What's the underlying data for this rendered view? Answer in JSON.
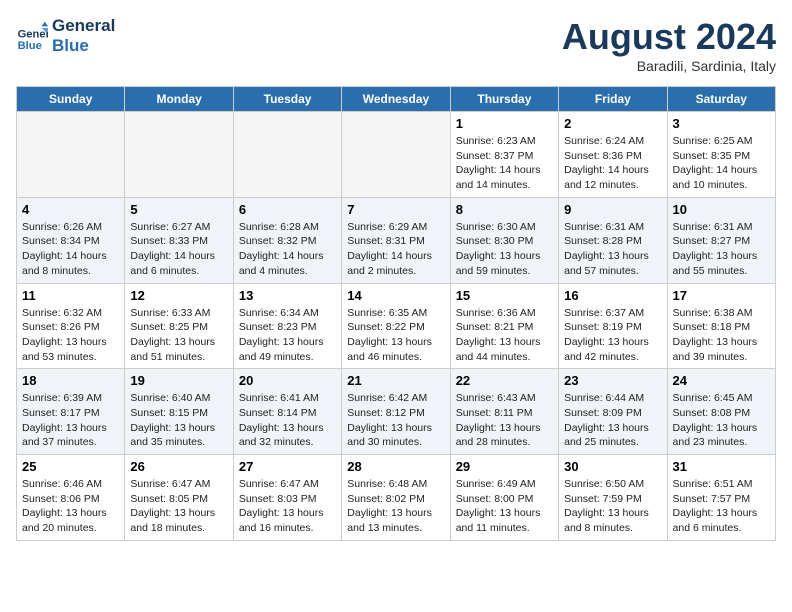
{
  "header": {
    "logo_line1": "General",
    "logo_line2": "Blue",
    "month": "August 2024",
    "location": "Baradili, Sardinia, Italy"
  },
  "days_of_week": [
    "Sunday",
    "Monday",
    "Tuesday",
    "Wednesday",
    "Thursday",
    "Friday",
    "Saturday"
  ],
  "weeks": [
    [
      {
        "day": "",
        "empty": true
      },
      {
        "day": "",
        "empty": true
      },
      {
        "day": "",
        "empty": true
      },
      {
        "day": "",
        "empty": true
      },
      {
        "day": "1",
        "sunrise": "6:23 AM",
        "sunset": "8:37 PM",
        "daylight": "14 hours and 14 minutes."
      },
      {
        "day": "2",
        "sunrise": "6:24 AM",
        "sunset": "8:36 PM",
        "daylight": "14 hours and 12 minutes."
      },
      {
        "day": "3",
        "sunrise": "6:25 AM",
        "sunset": "8:35 PM",
        "daylight": "14 hours and 10 minutes."
      }
    ],
    [
      {
        "day": "4",
        "sunrise": "6:26 AM",
        "sunset": "8:34 PM",
        "daylight": "14 hours and 8 minutes."
      },
      {
        "day": "5",
        "sunrise": "6:27 AM",
        "sunset": "8:33 PM",
        "daylight": "14 hours and 6 minutes."
      },
      {
        "day": "6",
        "sunrise": "6:28 AM",
        "sunset": "8:32 PM",
        "daylight": "14 hours and 4 minutes."
      },
      {
        "day": "7",
        "sunrise": "6:29 AM",
        "sunset": "8:31 PM",
        "daylight": "14 hours and 2 minutes."
      },
      {
        "day": "8",
        "sunrise": "6:30 AM",
        "sunset": "8:30 PM",
        "daylight": "13 hours and 59 minutes."
      },
      {
        "day": "9",
        "sunrise": "6:31 AM",
        "sunset": "8:28 PM",
        "daylight": "13 hours and 57 minutes."
      },
      {
        "day": "10",
        "sunrise": "6:31 AM",
        "sunset": "8:27 PM",
        "daylight": "13 hours and 55 minutes."
      }
    ],
    [
      {
        "day": "11",
        "sunrise": "6:32 AM",
        "sunset": "8:26 PM",
        "daylight": "13 hours and 53 minutes."
      },
      {
        "day": "12",
        "sunrise": "6:33 AM",
        "sunset": "8:25 PM",
        "daylight": "13 hours and 51 minutes."
      },
      {
        "day": "13",
        "sunrise": "6:34 AM",
        "sunset": "8:23 PM",
        "daylight": "13 hours and 49 minutes."
      },
      {
        "day": "14",
        "sunrise": "6:35 AM",
        "sunset": "8:22 PM",
        "daylight": "13 hours and 46 minutes."
      },
      {
        "day": "15",
        "sunrise": "6:36 AM",
        "sunset": "8:21 PM",
        "daylight": "13 hours and 44 minutes."
      },
      {
        "day": "16",
        "sunrise": "6:37 AM",
        "sunset": "8:19 PM",
        "daylight": "13 hours and 42 minutes."
      },
      {
        "day": "17",
        "sunrise": "6:38 AM",
        "sunset": "8:18 PM",
        "daylight": "13 hours and 39 minutes."
      }
    ],
    [
      {
        "day": "18",
        "sunrise": "6:39 AM",
        "sunset": "8:17 PM",
        "daylight": "13 hours and 37 minutes."
      },
      {
        "day": "19",
        "sunrise": "6:40 AM",
        "sunset": "8:15 PM",
        "daylight": "13 hours and 35 minutes."
      },
      {
        "day": "20",
        "sunrise": "6:41 AM",
        "sunset": "8:14 PM",
        "daylight": "13 hours and 32 minutes."
      },
      {
        "day": "21",
        "sunrise": "6:42 AM",
        "sunset": "8:12 PM",
        "daylight": "13 hours and 30 minutes."
      },
      {
        "day": "22",
        "sunrise": "6:43 AM",
        "sunset": "8:11 PM",
        "daylight": "13 hours and 28 minutes."
      },
      {
        "day": "23",
        "sunrise": "6:44 AM",
        "sunset": "8:09 PM",
        "daylight": "13 hours and 25 minutes."
      },
      {
        "day": "24",
        "sunrise": "6:45 AM",
        "sunset": "8:08 PM",
        "daylight": "13 hours and 23 minutes."
      }
    ],
    [
      {
        "day": "25",
        "sunrise": "6:46 AM",
        "sunset": "8:06 PM",
        "daylight": "13 hours and 20 minutes."
      },
      {
        "day": "26",
        "sunrise": "6:47 AM",
        "sunset": "8:05 PM",
        "daylight": "13 hours and 18 minutes."
      },
      {
        "day": "27",
        "sunrise": "6:47 AM",
        "sunset": "8:03 PM",
        "daylight": "13 hours and 16 minutes."
      },
      {
        "day": "28",
        "sunrise": "6:48 AM",
        "sunset": "8:02 PM",
        "daylight": "13 hours and 13 minutes."
      },
      {
        "day": "29",
        "sunrise": "6:49 AM",
        "sunset": "8:00 PM",
        "daylight": "13 hours and 11 minutes."
      },
      {
        "day": "30",
        "sunrise": "6:50 AM",
        "sunset": "7:59 PM",
        "daylight": "13 hours and 8 minutes."
      },
      {
        "day": "31",
        "sunrise": "6:51 AM",
        "sunset": "7:57 PM",
        "daylight": "13 hours and 6 minutes."
      }
    ]
  ],
  "labels": {
    "sunrise": "Sunrise:",
    "sunset": "Sunset:",
    "daylight": "Daylight:"
  }
}
